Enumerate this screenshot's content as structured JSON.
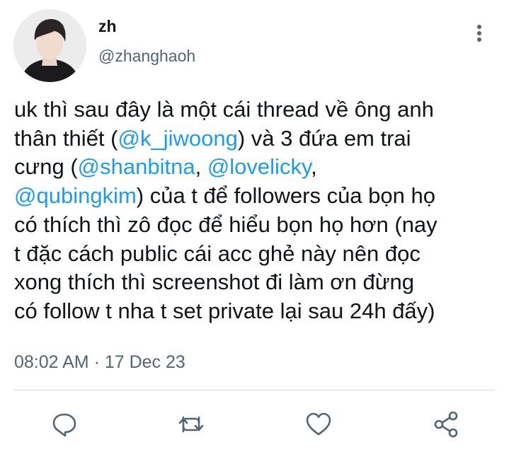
{
  "user": {
    "display_name": "zh",
    "handle": "@zhanghaoh"
  },
  "tweet": {
    "lines": [
      [
        {
          "t": "uk thì sau đây là một cái thread về ông anh"
        }
      ],
      [
        {
          "t": "thân thiết ("
        },
        {
          "t": "@k_jiwoong",
          "m": true
        },
        {
          "t": ") và 3 đứa em trai"
        }
      ],
      [
        {
          "t": "cưng ("
        },
        {
          "t": "@shanbitna",
          "m": true
        },
        {
          "t": ", "
        },
        {
          "t": "@lovelicky",
          "m": true
        },
        {
          "t": ","
        }
      ],
      [
        {
          "t": "@qubingkim",
          "m": true
        },
        {
          "t": ") của t để followers của bọn họ"
        }
      ],
      [
        {
          "t": "có thích thì zô đọc để hiểu bọn họ hơn (nay"
        }
      ],
      [
        {
          "t": "t đặc cách public cái acc ghẻ này nên đọc"
        }
      ],
      [
        {
          "t": "xong thích thì screenshot đi làm ơn đừng"
        }
      ],
      [
        {
          "t": "có follow t nha t set private lại sau 24h đấy)"
        }
      ]
    ],
    "timestamp": "08:02 AM · 17 Dec 23"
  },
  "colors": {
    "mention": "#1d9bf0",
    "secondary_text": "#536471",
    "icon": "#536471"
  },
  "actions": [
    "reply-icon",
    "retweet-icon",
    "like-icon",
    "share-icon"
  ]
}
